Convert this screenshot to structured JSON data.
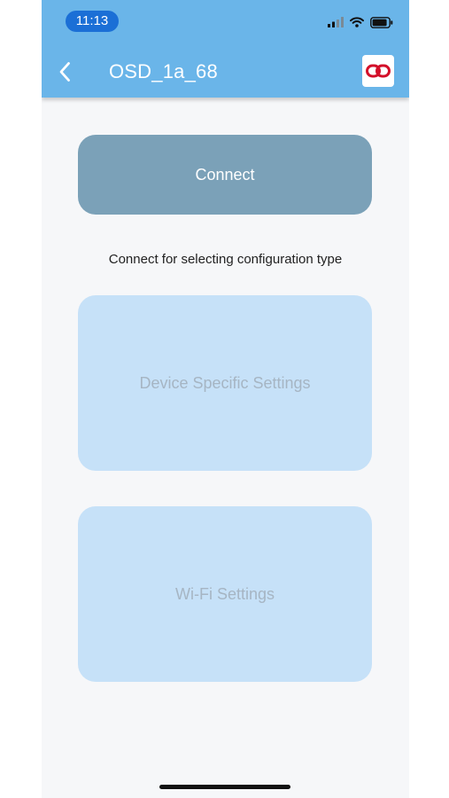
{
  "status_bar": {
    "time": "11:13"
  },
  "header": {
    "title": "OSD_1a_68",
    "back_icon": "chevron-left-icon",
    "link_icon": "link-icon",
    "accent_color": "#6ab5e9",
    "link_icon_color": "#d3102a"
  },
  "main": {
    "connect_label": "Connect",
    "hint_text": "Connect for selecting configuration type",
    "device_settings_label": "Device Specific Settings",
    "wifi_settings_label": "Wi-Fi Settings",
    "options_enabled": false
  }
}
